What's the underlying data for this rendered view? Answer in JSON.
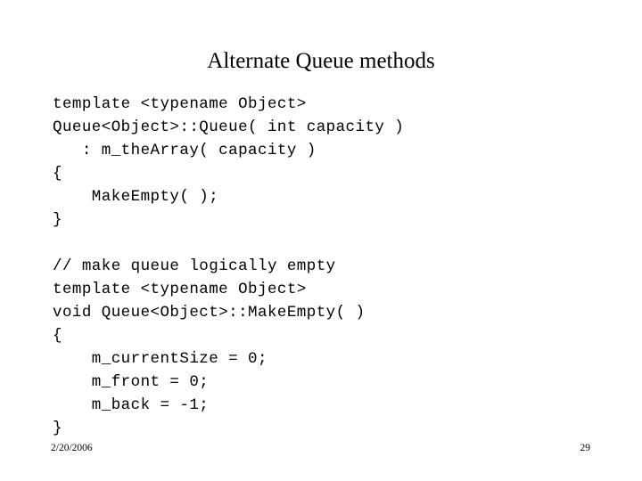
{
  "slide": {
    "title": "Alternate Queue methods",
    "background_color": "#ffffff",
    "text_color": "#000000",
    "code_lines": [
      "template <typename Object>",
      "Queue<Object>::Queue( int capacity )",
      "   : m_theArray( capacity )",
      "{",
      "    MakeEmpty( );",
      "}",
      "",
      "// make queue logically empty",
      "template <typename Object>",
      "void Queue<Object>::MakeEmpty( )",
      "{",
      "    m_currentSize = 0;",
      "    m_front = 0;",
      "    m_back = -1;",
      "}"
    ],
    "footer": {
      "date": "2/20/2006",
      "page_number": "29"
    }
  }
}
